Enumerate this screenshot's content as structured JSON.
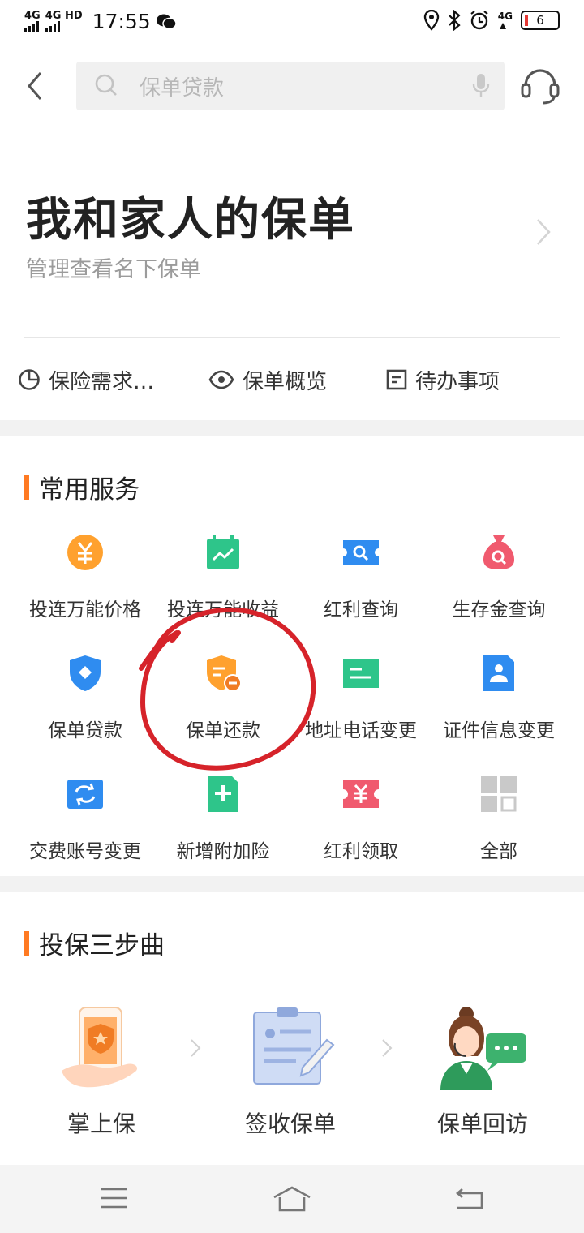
{
  "status": {
    "network1": "4G",
    "network2": "4G HD",
    "time": "17:55",
    "network3": "4G",
    "battery": "6",
    "icons": [
      "wechat-icon",
      "location-icon",
      "bluetooth-icon",
      "alarm-icon"
    ]
  },
  "header": {
    "search_placeholder": "保单贷款",
    "icons": [
      "back-icon",
      "search-icon",
      "mic-icon",
      "customer-service-icon"
    ]
  },
  "my_policy": {
    "title": "我和家人的保单",
    "subtitle": "管理查看名下保单",
    "quick_links": [
      {
        "label": "保险需求…",
        "icon": "pie-chart-icon"
      },
      {
        "label": "保单概览",
        "icon": "eye-icon"
      },
      {
        "label": "待办事项",
        "icon": "todo-icon"
      }
    ]
  },
  "common_services": {
    "title": "常用服务",
    "items": [
      {
        "label": "投连万能价格",
        "icon": "yuan-coin-icon",
        "color": "#ffa12e"
      },
      {
        "label": "投连万能收益",
        "icon": "trend-calendar-icon",
        "color": "#2ec58a"
      },
      {
        "label": "红利查询",
        "icon": "ticket-search-icon",
        "color": "#2f8cf0"
      },
      {
        "label": "生存金查询",
        "icon": "money-bag-icon",
        "color": "#f05a6e"
      },
      {
        "label": "保单贷款",
        "icon": "shield-icon",
        "color": "#2f8cf0"
      },
      {
        "label": "保单还款",
        "icon": "repay-shield-icon",
        "color": "#ffa12e"
      },
      {
        "label": "地址电话变更",
        "icon": "contact-card-icon",
        "color": "#2ec58a"
      },
      {
        "label": "证件信息变更",
        "icon": "id-card-icon",
        "color": "#2f8cf0"
      },
      {
        "label": "交费账号变更",
        "icon": "exchange-icon",
        "color": "#2f8cf0"
      },
      {
        "label": "新增附加险",
        "icon": "add-document-icon",
        "color": "#2ec58a"
      },
      {
        "label": "红利领取",
        "icon": "yuan-ticket-icon",
        "color": "#f05a6e"
      },
      {
        "label": "全部",
        "icon": "grid-all-icon",
        "color": "#c9c9c9"
      }
    ]
  },
  "steps": {
    "title": "投保三步曲",
    "items": [
      {
        "label": "掌上保",
        "icon": "phone-hand-shield-icon"
      },
      {
        "label": "签收保单",
        "icon": "clipboard-sign-icon"
      },
      {
        "label": "保单回访",
        "icon": "agent-chat-icon"
      }
    ]
  },
  "nav": {
    "icons": [
      "menu-icon",
      "home-icon",
      "back-nav-icon"
    ]
  },
  "annotation": {
    "color": "#d6232a"
  }
}
